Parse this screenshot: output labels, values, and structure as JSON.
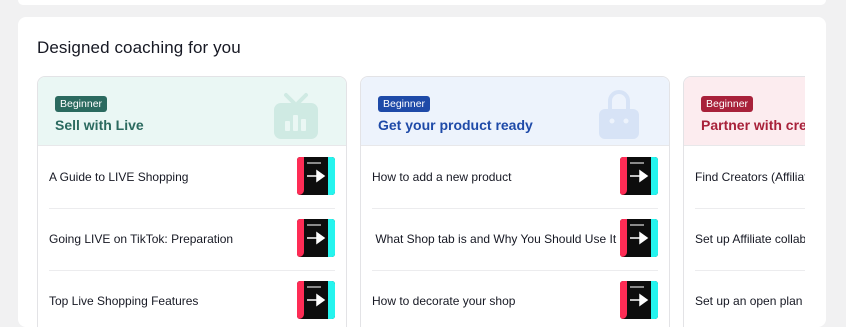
{
  "section": {
    "title": "Designed coaching for you"
  },
  "colors": {
    "teal": "#2b6a5f",
    "teal_bg": "#eaf7f4",
    "blue": "#1e4aa8",
    "blue_bg": "#edf3fc",
    "red": "#a8213a",
    "red_bg": "#fcecef"
  },
  "cards": [
    {
      "badge": "Beginner",
      "title": "Sell with Live",
      "illustration": "tv-chart-icon",
      "lessons": [
        {
          "title": "A Guide to LIVE Shopping"
        },
        {
          "title": "Going LIVE on TikTok: Preparation"
        },
        {
          "title": "Top Live Shopping Features"
        }
      ]
    },
    {
      "badge": "Beginner",
      "title": "Get your product ready",
      "illustration": "shopping-bag-icon",
      "lessons": [
        {
          "title": "How to add a new product"
        },
        {
          "title": " What Shop tab is and Why You Should Use It"
        },
        {
          "title": "How to decorate your shop"
        }
      ]
    },
    {
      "badge": "Beginner",
      "title": "Partner with creators",
      "illustration": "people-icon",
      "lessons": [
        {
          "title": "Find Creators (Affiliate)"
        },
        {
          "title": "Set up Affiliate collaboration"
        },
        {
          "title": "Set up an open plan"
        }
      ]
    }
  ]
}
